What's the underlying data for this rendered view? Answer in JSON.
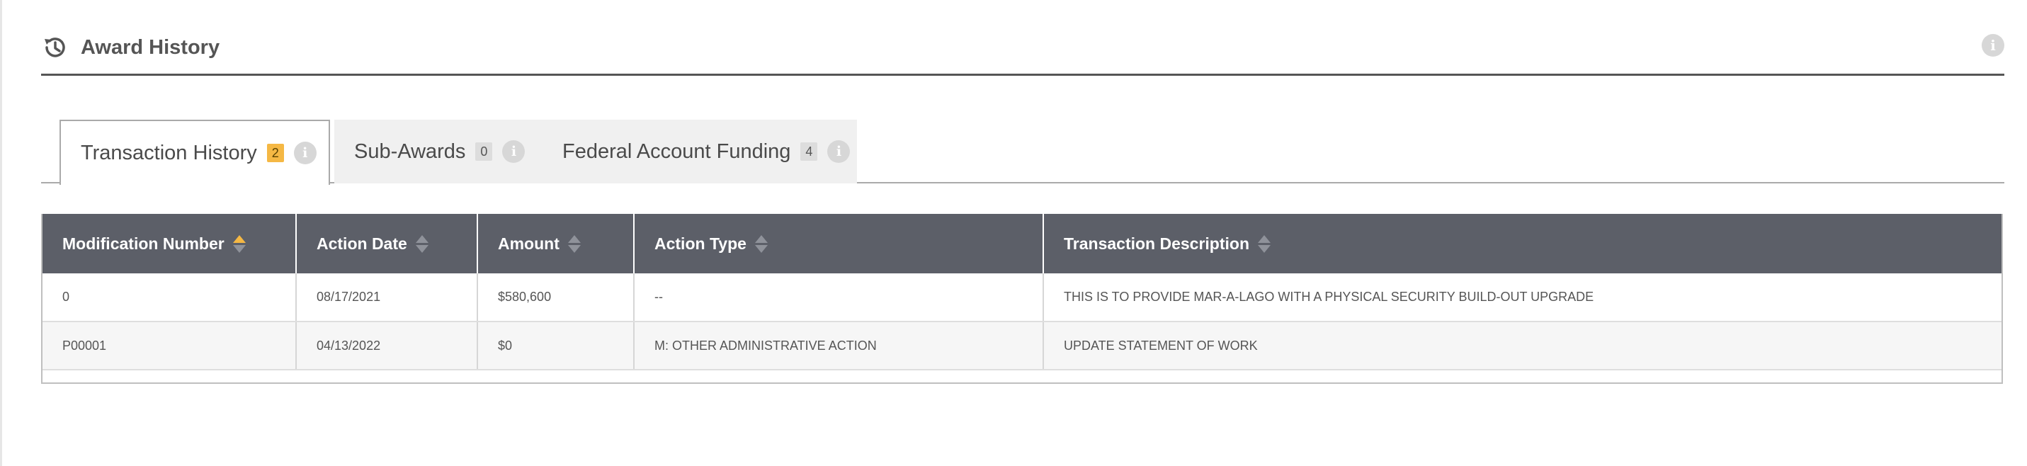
{
  "section": {
    "title": "Award History",
    "icon": "history-icon",
    "info_icon": "info-icon"
  },
  "tabs": [
    {
      "label": "Transaction History",
      "count": "2",
      "active": true
    },
    {
      "label": "Sub-Awards",
      "count": "0",
      "active": false
    },
    {
      "label": "Federal Account Funding",
      "count": "4",
      "active": false
    }
  ],
  "table": {
    "columns": [
      "Modification Number",
      "Action Date",
      "Amount",
      "Action Type",
      "Transaction Description"
    ],
    "sorted_column": "Modification Number",
    "sort_direction": "ascending",
    "rows": [
      {
        "modification_number": "0",
        "action_date": "08/17/2021",
        "amount": "$580,600",
        "action_type": "--",
        "description": "THIS IS TO PROVIDE MAR-A-LAGO WITH A PHYSICAL SECURITY BUILD-OUT UPGRADE"
      },
      {
        "modification_number": "P00001",
        "action_date": "04/13/2022",
        "amount": "$0",
        "action_type": "M: OTHER ADMINISTRATIVE ACTION",
        "description": "UPDATE STATEMENT OF WORK"
      }
    ]
  },
  "colors": {
    "header_bg": "#5c5f68",
    "accent": "#f5b844",
    "text": "#555555"
  }
}
